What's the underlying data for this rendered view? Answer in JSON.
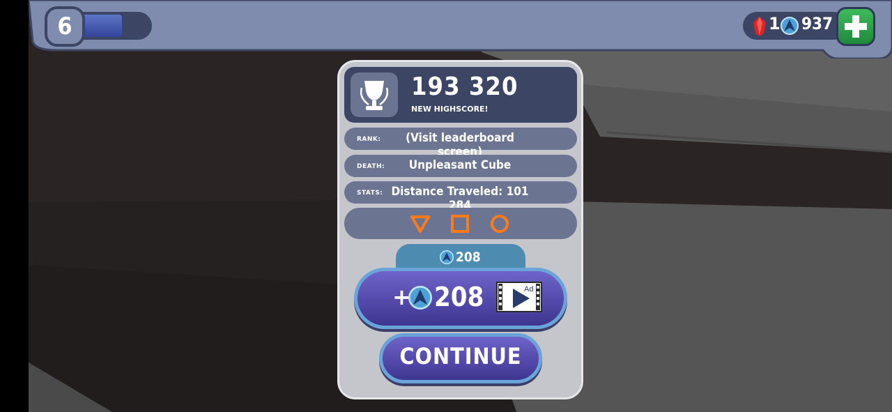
{
  "hud": {
    "level": "6",
    "xp_progress": 0.6,
    "gems": "1",
    "coins": "937"
  },
  "results": {
    "score": "193 320",
    "score_caption": "NEW HIGHSCORE!",
    "rank_label": "RANK:",
    "rank_value": "(Visit leaderboard screen)",
    "death_label": "DEATH:",
    "death_value": "Unpleasant Cube",
    "stats_label": "STATS:",
    "stats_value": "Distance Traveled: 101 284",
    "shapes": [
      "triangle-icon",
      "square-icon",
      "circle-icon"
    ]
  },
  "reward": {
    "tab_amount": "208",
    "plus_sign": "+",
    "ad_amount": "208",
    "ad_badge": "Ad"
  },
  "actions": {
    "continue_label": "CONTINUE"
  },
  "colors": {
    "hud": "#7f8cae",
    "panel_dark": "#3c4563",
    "row": "#6b7592",
    "shape_orange": "#ff7a1a",
    "button_purple": "#5a4fb4",
    "add_green": "#2fa44c"
  }
}
